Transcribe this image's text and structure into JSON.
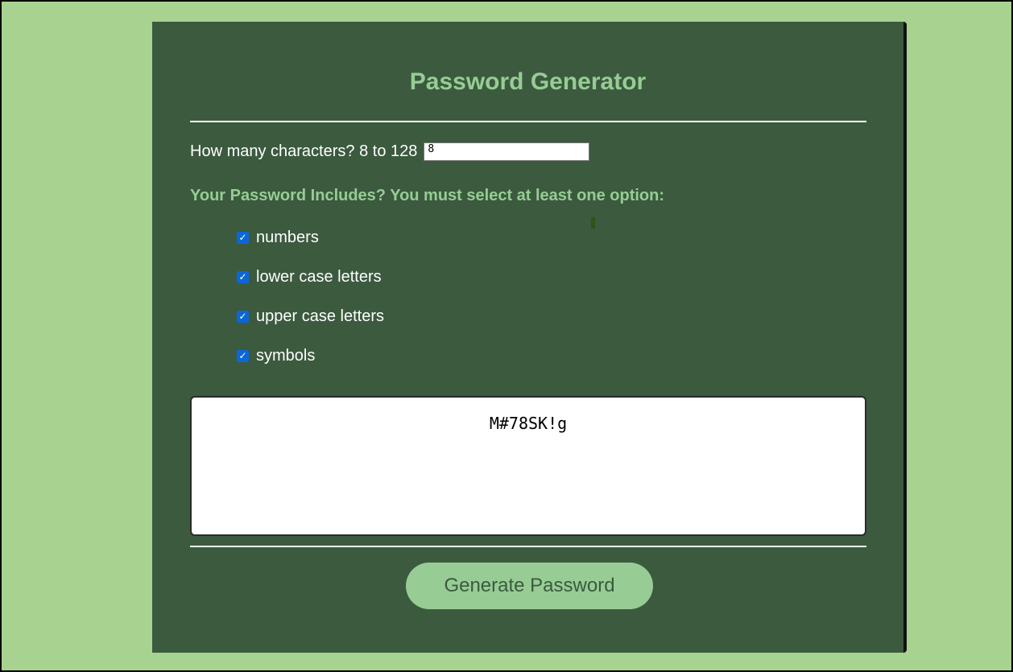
{
  "title": "Password Generator",
  "length": {
    "label": "How many characters? 8 to 128",
    "value": "8"
  },
  "criteria_label": "Your Password Includes? You must select at least one option:",
  "options": [
    {
      "label": "numbers",
      "checked": true
    },
    {
      "label": "lower case letters",
      "checked": true
    },
    {
      "label": "upper case letters",
      "checked": true
    },
    {
      "label": "symbols",
      "checked": true
    }
  ],
  "password": "M#78SK!g",
  "generate_button": "Generate Password",
  "colors": {
    "background": "#a8d28f",
    "card": "#3b5a3e",
    "accent": "#97cc95",
    "checkbox": "#0b67d8"
  },
  "icons": {
    "checkbox": "check-icon"
  }
}
